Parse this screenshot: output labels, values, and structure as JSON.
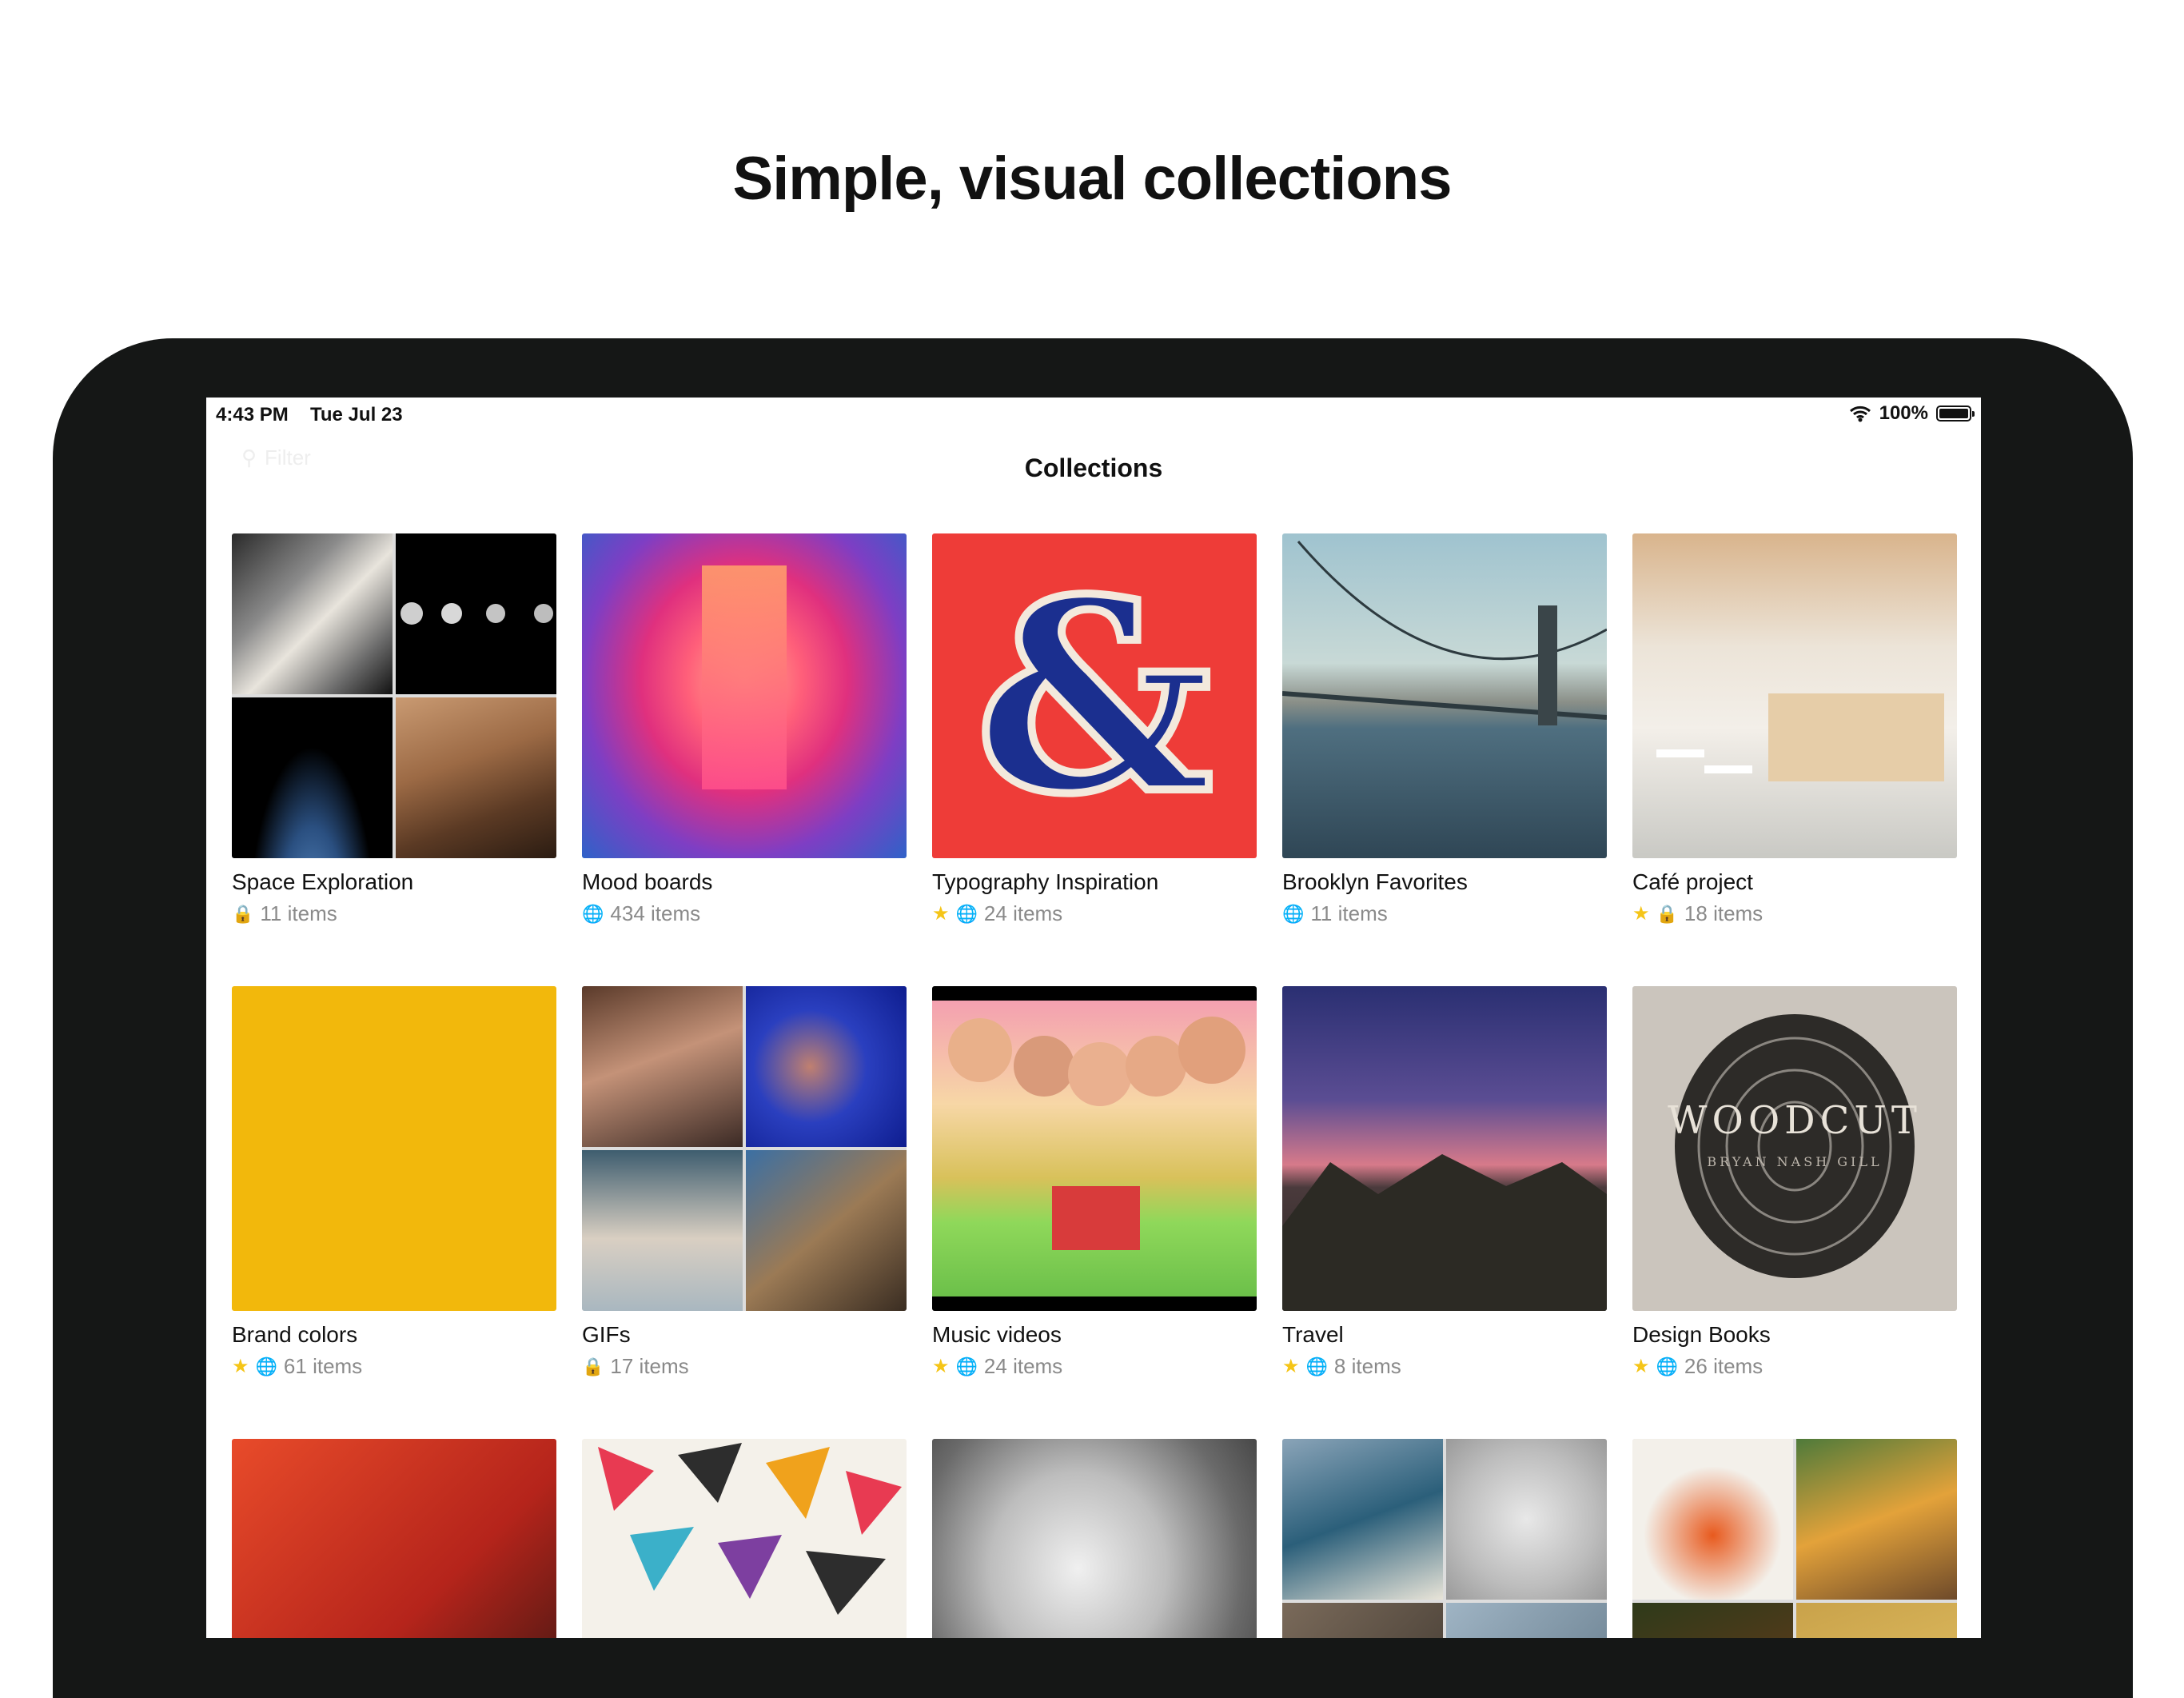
{
  "headline": "Simple, visual collections",
  "status": {
    "time": "4:43 PM",
    "date": "Tue Jul 23",
    "battery": "100%"
  },
  "filter": {
    "placeholder": "Filter"
  },
  "nav": {
    "title": "Collections"
  },
  "collections": [
    {
      "title": "Space Exploration",
      "items": "11 items",
      "favorite": false,
      "privacy": "private",
      "cover": "space-collage"
    },
    {
      "title": "Mood boards",
      "items": "434 items",
      "favorite": false,
      "privacy": "public",
      "cover": "neon-corridor"
    },
    {
      "title": "Typography Inspiration",
      "items": "24 items",
      "favorite": true,
      "privacy": "public",
      "cover": "ampersand"
    },
    {
      "title": "Brooklyn Favorites",
      "items": "11 items",
      "favorite": false,
      "privacy": "public",
      "cover": "bridge"
    },
    {
      "title": "Café project",
      "items": "18 items",
      "favorite": true,
      "privacy": "private",
      "cover": "cafe-interior"
    },
    {
      "title": "Brand colors",
      "items": "61 items",
      "favorite": true,
      "privacy": "public",
      "cover": "yellow-swatch"
    },
    {
      "title": "GIFs",
      "items": "17 items",
      "favorite": false,
      "privacy": "private",
      "cover": "gif-collage"
    },
    {
      "title": "Music videos",
      "items": "24 items",
      "favorite": true,
      "privacy": "public",
      "cover": "band-illustration"
    },
    {
      "title": "Travel",
      "items": "8 items",
      "favorite": true,
      "privacy": "public",
      "cover": "valley-sunset"
    },
    {
      "title": "Design Books",
      "items": "26 items",
      "favorite": true,
      "privacy": "public",
      "cover": "woodcut-book",
      "cover_text": "WOODCUT",
      "cover_subtext": "BRYAN NASH GILL"
    },
    {
      "cover": "red-stage"
    },
    {
      "cover": "triangle-pattern"
    },
    {
      "cover": "astronaut-bw"
    },
    {
      "cover": "wave-collage"
    },
    {
      "cover": "cocktail-collage"
    }
  ],
  "colors": {
    "brand_yellow": "#f2b80c",
    "typography_red": "#ee3c38",
    "typography_blue": "#1b2f8f",
    "star": "#f5c518"
  }
}
